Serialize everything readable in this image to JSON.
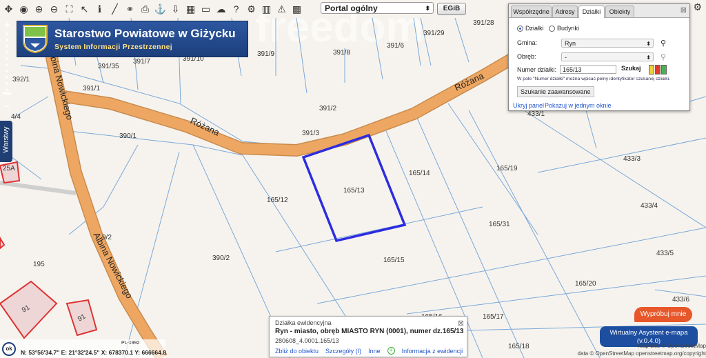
{
  "toolbar": {
    "portal": "Portal ogólny",
    "egib": "EGiB"
  },
  "logo": {
    "title": "Starostwo Powiatowe w Giżycku",
    "subtitle": "System Informacji Przestrzennej"
  },
  "layers_tab": "Warstwy",
  "map": {
    "parcel_labels": [
      "391/28",
      "391/29",
      "391/9",
      "391/8",
      "391/6",
      "391/35",
      "391/7",
      "391/10",
      "391/1",
      "391/2",
      "391/3",
      "390/1",
      "165/13",
      "165/14",
      "165/12",
      "165/19",
      "433/3",
      "433/4",
      "165/31",
      "390/2",
      "165/15",
      "433/5",
      "165/20",
      "433/6",
      "165/16",
      "165/18",
      "195",
      "9/2",
      "392/1",
      "4/4",
      "433/1",
      "91",
      "91",
      "25A",
      "165/17"
    ],
    "road_labels": [
      "Różana",
      "Różana",
      "Albina Nowickiego",
      "Albina Nowickiego"
    ],
    "highlight_parcel": "165/13",
    "watermark": "freedom"
  },
  "search_panel": {
    "tabs": [
      "Współrzędne",
      "Adresy",
      "Działki",
      "Obiekty"
    ],
    "active_tab": "Działki",
    "radio_dzialki": "Działki",
    "radio_budynki": "Budynki",
    "gmina_label": "Gmina:",
    "gmina_value": "Ryn",
    "obreb_label": "Obręb:",
    "obreb_value": "-",
    "numer_label": "Numer działki:",
    "numer_value": "165/13",
    "szukaj": "Szukaj",
    "hint": "W pole \"Numer działki\" można wpisać pełny identyfikator szukanej działki.",
    "advanced": "Szukanie zaawansowane",
    "hide_panel": "Ukryj panel",
    "show_one_window": "Pokazuj w jednym oknie"
  },
  "info_popup": {
    "title": "Działka ewidencyjna",
    "main_text": "Ryn - miasto, obręb MIASTO RYN (0001), numer dz.165/13",
    "identifier": "280608_4.0001.165/13",
    "links": [
      "Zbliż do obiektu",
      "Szczegóły (I)",
      "Inne",
      "Informacja z ewidencji"
    ]
  },
  "try_button": "Wypróbuj mnie",
  "assistant": {
    "line1": "Wirtualny Asystent e-mapa",
    "line2": "(v.0.4.0)"
  },
  "attribution": {
    "line1": "Map tiles © OpenStreetMap",
    "line2": "data © OpenStreetMap openstreetmap.org/copyright"
  },
  "coordbar": {
    "ok": "ok",
    "crs": "PL-1992",
    "coords": "N: 53°56'34.7'' E: 21°32'24.5'' X: 678370.1 Y: 666664.8"
  },
  "colors": {
    "highlight": "#2c2ce0",
    "road": "#eea762",
    "parcel_line": "#7aa8d8",
    "panel_blue": "#1d3f7c",
    "orange": "#e8572a"
  }
}
